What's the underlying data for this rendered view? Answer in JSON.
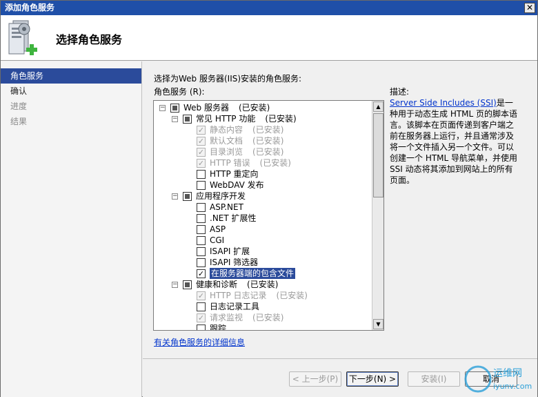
{
  "window": {
    "title": "添加角色服务",
    "close_glyph": "✕"
  },
  "header": {
    "title": "选择角色服务",
    "icon": "server-add-icon"
  },
  "nav": {
    "items": [
      {
        "label": "角色服务",
        "state": "active"
      },
      {
        "label": "确认",
        "state": "normal"
      },
      {
        "label": "进度",
        "state": "dim"
      },
      {
        "label": "结果",
        "state": "dim"
      }
    ]
  },
  "main": {
    "prompt": "选择为Web 服务器(IIS)安装的角色服务:",
    "list_label": "角色服务 (R):",
    "more_link": "有关角色服务的详细信息"
  },
  "tree": [
    {
      "label": "Web 服务器",
      "status": "(已安装)",
      "level": 0,
      "expander": "minus",
      "check": "partial"
    },
    {
      "label": "常见 HTTP 功能",
      "status": "(已安装)",
      "level": 1,
      "expander": "minus",
      "check": "partial"
    },
    {
      "label": "静态内容",
      "status": "(已安装)",
      "level": 2,
      "check": "checked-disabled"
    },
    {
      "label": "默认文档",
      "status": "(已安装)",
      "level": 2,
      "check": "checked-disabled"
    },
    {
      "label": "目录浏览",
      "status": "(已安装)",
      "level": 2,
      "check": "checked-disabled"
    },
    {
      "label": "HTTP 错误",
      "status": "(已安装)",
      "level": 2,
      "check": "checked-disabled"
    },
    {
      "label": "HTTP 重定向",
      "status": "",
      "level": 2,
      "check": "unchecked"
    },
    {
      "label": "WebDAV 发布",
      "status": "",
      "level": 2,
      "check": "unchecked"
    },
    {
      "label": "应用程序开发",
      "status": "",
      "level": 1,
      "expander": "minus",
      "check": "partial"
    },
    {
      "label": "ASP.NET",
      "status": "",
      "level": 2,
      "check": "unchecked"
    },
    {
      "label": ".NET 扩展性",
      "status": "",
      "level": 2,
      "check": "unchecked"
    },
    {
      "label": "ASP",
      "status": "",
      "level": 2,
      "check": "unchecked"
    },
    {
      "label": "CGI",
      "status": "",
      "level": 2,
      "check": "unchecked"
    },
    {
      "label": "ISAPI 扩展",
      "status": "",
      "level": 2,
      "check": "unchecked"
    },
    {
      "label": "ISAPI 筛选器",
      "status": "",
      "level": 2,
      "check": "unchecked"
    },
    {
      "label": "在服务器端的包含文件",
      "status": "",
      "level": 2,
      "check": "checked",
      "selected": true
    },
    {
      "label": "健康和诊断",
      "status": "(已安装)",
      "level": 1,
      "expander": "minus",
      "check": "partial"
    },
    {
      "label": "HTTP 日志记录",
      "status": "(已安装)",
      "level": 2,
      "check": "checked-disabled"
    },
    {
      "label": "日志记录工具",
      "status": "",
      "level": 2,
      "check": "unchecked"
    },
    {
      "label": "请求监视",
      "status": "(已安装)",
      "level": 2,
      "check": "checked-disabled"
    },
    {
      "label": "跟踪",
      "status": "",
      "level": 2,
      "check": "unchecked"
    }
  ],
  "description": {
    "label": "描述:",
    "link": "Server Side Includes (SSI)",
    "text": "是一种用于动态生成 HTML 页的脚本语言。该脚本在页面传递到客户端之前在服务器上运行，并且通常涉及将一个文件插入另一个文件。可以创建一个 HTML 导航菜单，并使用 SSI 动态将其添加到网站上的所有页面。"
  },
  "footer": {
    "prev": "< 上一步(P)",
    "next": "下一步(N) >",
    "install": "安装(I)",
    "cancel": "取消"
  },
  "watermark": {
    "text": "运维网",
    "subtext": "iyunv.com"
  },
  "colors": {
    "titlebar": "#1f4fa8",
    "selection": "#2b4b9b",
    "link": "#0033cc"
  }
}
